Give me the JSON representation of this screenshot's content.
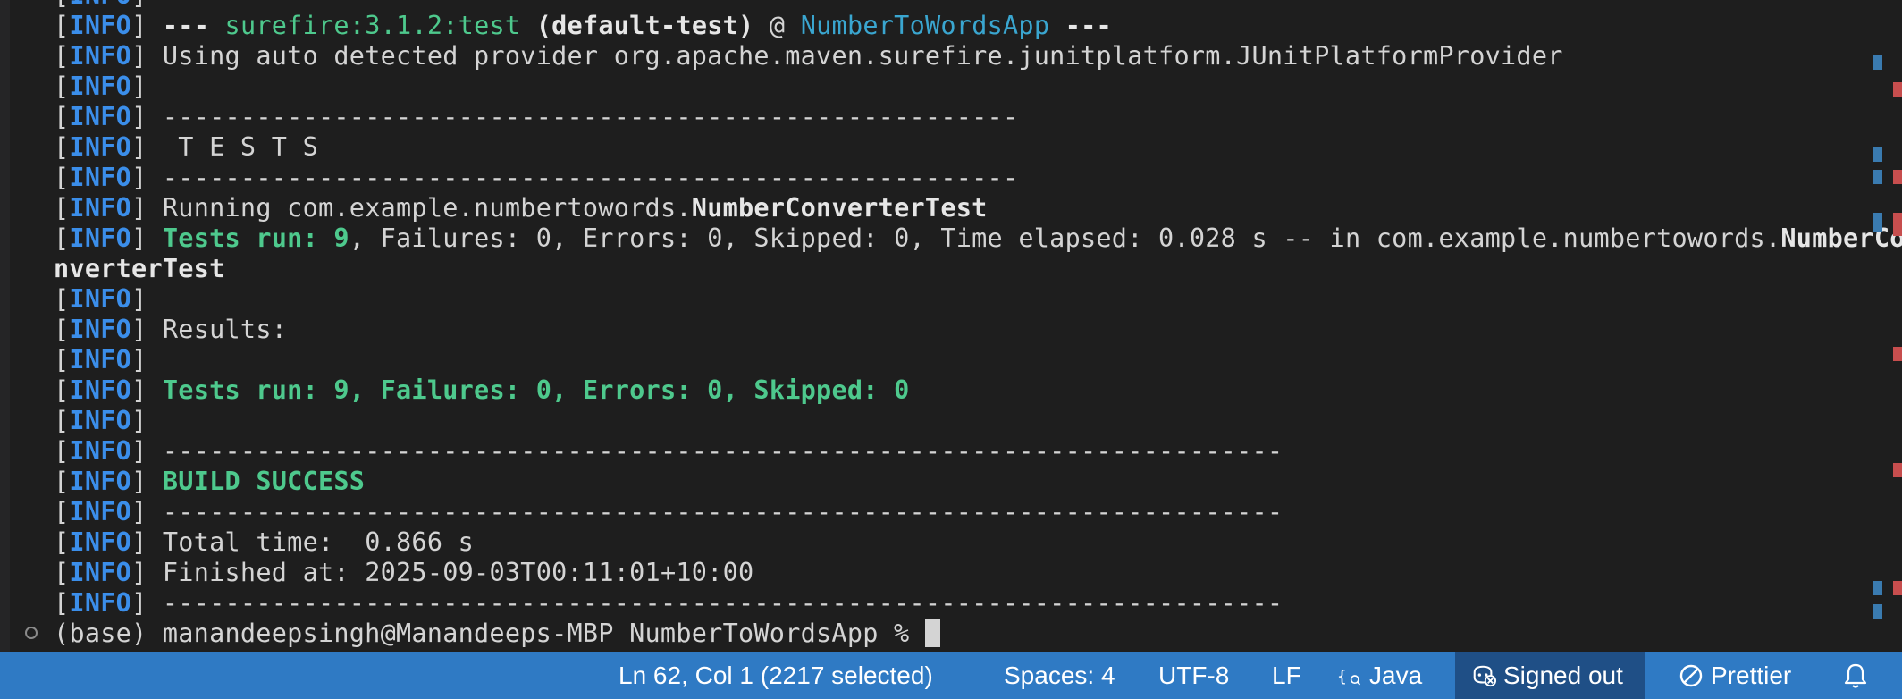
{
  "terminal": {
    "line_top": "[INFO]",
    "plugin_line": {
      "prefix": "---",
      "plugin": "surefire:3.1.2:test",
      "execution": "(default-test)",
      "at": "@",
      "project": "NumberToWordsApp",
      "suffix": "---"
    },
    "provider_line": "Using auto detected provider org.apache.maven.surefire.junitplatform.JUnitPlatformProvider",
    "dash_short": "-------------------------------------------------------",
    "tests_header": " T E S T S",
    "running_prefix": "Running com.example.numbertowords.",
    "running_class": "NumberConverterTest",
    "tests_run_green": "Tests run: 9",
    "tests_run_rest": ", Failures: 0, Errors: 0, Skipped: 0, Time elapsed: 0.028 s -- in com.example.numbertowords.",
    "tests_run_class_a": "NumberCo",
    "tests_run_class_b": "nverterTest",
    "results_label": "Results:",
    "summary": "Tests run: 9, Failures: 0, Errors: 0, Skipped: 0",
    "dash_long": "------------------------------------------------------------------------",
    "build_status": "BUILD SUCCESS",
    "total_time": "Total time:  0.866 s",
    "finished_at": "Finished at: 2025-09-03T00:11:01+10:00",
    "info_tag": "INFO",
    "prompt": "(base) manandeepsingh@Manandeeps-MBP NumberToWordsApp % "
  },
  "statusbar": {
    "cursor_position": "Ln 62, Col 1 (2217 selected)",
    "indent": "Spaces: 4",
    "encoding": "UTF-8",
    "eol": "LF",
    "language": "Java",
    "account": "Signed out",
    "formatter": "Prettier"
  },
  "icons": [
    "braces-icon",
    "copilot-signed-out-icon",
    "prettier-icon",
    "bell-icon"
  ],
  "colors": {
    "info": "#3b8eea",
    "success": "#4ec98d",
    "statusbar": "#2f7ac4",
    "background": "#1e1e1e"
  }
}
